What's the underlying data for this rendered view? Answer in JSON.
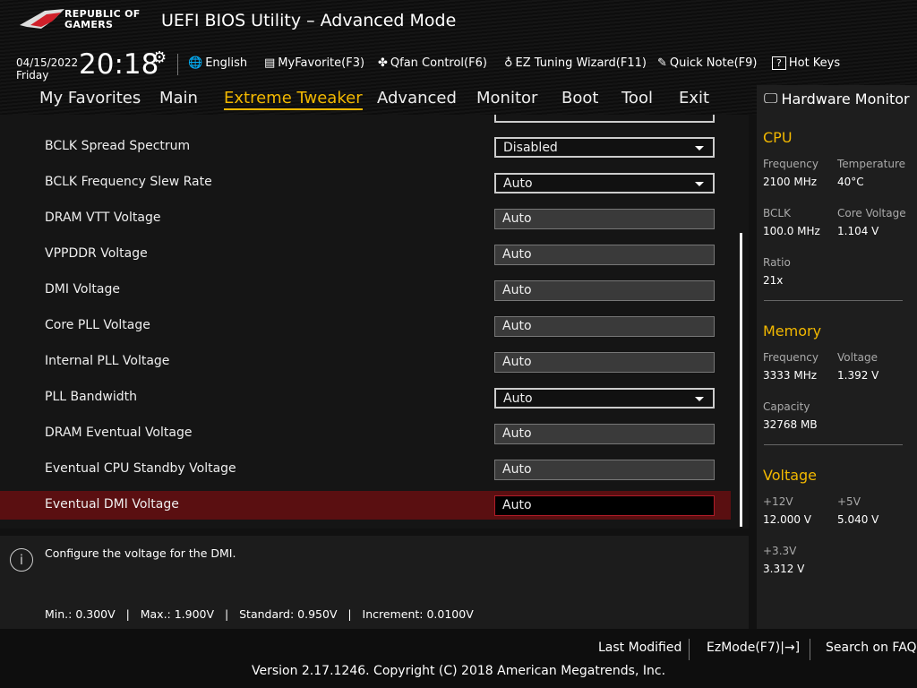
{
  "header": {
    "brand_line1": "REPUBLIC OF",
    "brand_line2": "GAMERS",
    "title": "UEFI BIOS Utility – Advanced Mode",
    "date": "04/15/2022",
    "day": "Friday",
    "time": "20:18"
  },
  "toolbar": [
    {
      "icon": "globe-icon",
      "label": "English"
    },
    {
      "icon": "favorite-icon",
      "label": "MyFavorite(F3)"
    },
    {
      "icon": "fan-icon",
      "label": "Qfan Control(F6)"
    },
    {
      "icon": "bulb-icon",
      "label": "EZ Tuning Wizard(F11)"
    },
    {
      "icon": "note-icon",
      "label": "Quick Note(F9)"
    },
    {
      "icon": "help-icon",
      "label": "Hot Keys"
    }
  ],
  "tabs": [
    "My Favorites",
    "Main",
    "Extreme Tweaker",
    "Advanced",
    "Monitor",
    "Boot",
    "Tool",
    "Exit"
  ],
  "active_tab": "Extreme Tweaker",
  "settings": [
    {
      "label": "BCLK Spread Spectrum",
      "value": "Disabled",
      "type": "dropdown"
    },
    {
      "label": "BCLK Frequency Slew Rate",
      "value": "Auto",
      "type": "dropdown"
    },
    {
      "label": "DRAM VTT Voltage",
      "value": "Auto",
      "type": "text"
    },
    {
      "label": "VPPDDR Voltage",
      "value": "Auto",
      "type": "text"
    },
    {
      "label": "DMI Voltage",
      "value": "Auto",
      "type": "text"
    },
    {
      "label": "Core PLL Voltage",
      "value": "Auto",
      "type": "text"
    },
    {
      "label": "Internal PLL Voltage",
      "value": "Auto",
      "type": "text"
    },
    {
      "label": "PLL Bandwidth",
      "value": "Auto",
      "type": "dropdown"
    },
    {
      "label": "DRAM Eventual Voltage",
      "value": "Auto",
      "type": "text"
    },
    {
      "label": "Eventual CPU Standby Voltage",
      "value": "Auto",
      "type": "text"
    },
    {
      "label": "Eventual DMI Voltage",
      "value": "Auto",
      "type": "text",
      "selected": true
    }
  ],
  "help": {
    "text": "Configure the voltage for the DMI.",
    "limits": "Min.: 0.300V   |   Max.: 1.900V   |   Standard: 0.950V   |   Increment: 0.0100V"
  },
  "hw_monitor": {
    "title": "Hardware Monitor",
    "sections": [
      {
        "name": "CPU",
        "items": [
          {
            "k": "Frequency",
            "v": "2100 MHz"
          },
          {
            "k": "Temperature",
            "v": "40°C"
          },
          {
            "k": "BCLK",
            "v": "100.0 MHz"
          },
          {
            "k": "Core Voltage",
            "v": "1.104 V"
          },
          {
            "k": "Ratio",
            "v": "21x"
          }
        ]
      },
      {
        "name": "Memory",
        "items": [
          {
            "k": "Frequency",
            "v": "3333 MHz"
          },
          {
            "k": "Voltage",
            "v": "1.392 V"
          },
          {
            "k": "Capacity",
            "v": "32768 MB"
          }
        ]
      },
      {
        "name": "Voltage",
        "items": [
          {
            "k": "+12V",
            "v": "12.000 V"
          },
          {
            "k": "+5V",
            "v": "5.040 V"
          },
          {
            "k": "+3.3V",
            "v": "3.312 V"
          }
        ]
      }
    ]
  },
  "footer": {
    "last_modified": "Last Modified",
    "ezmode": "EzMode(F7)|→]",
    "faq": "Search on FAQ",
    "version": "Version 2.17.1246. Copyright (C) 2018 American Megatrends, Inc."
  },
  "colors": {
    "accent": "#f2b800",
    "selected_row": "#5a0f11"
  }
}
